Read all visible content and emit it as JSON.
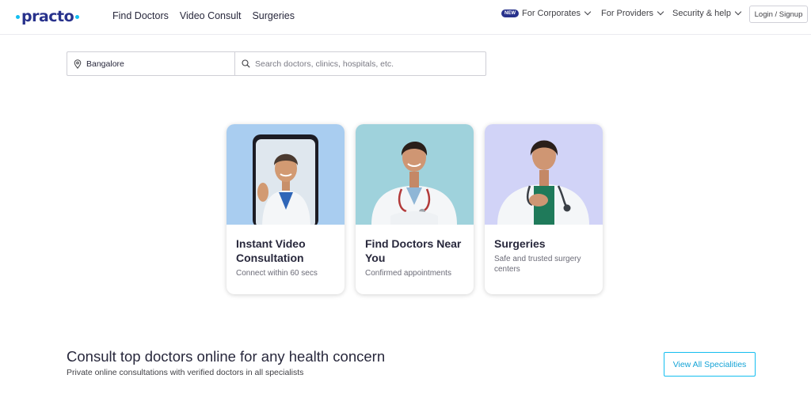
{
  "header": {
    "logo_text": "practo",
    "nav": [
      "Find Doctors",
      "Video Consult",
      "Surgeries"
    ],
    "corporates_badge": "NEW",
    "corporates_label": "For Corporates",
    "providers_label": "For Providers",
    "security_label": "Security & help",
    "login_label": "Login / Signup"
  },
  "search": {
    "location_value": "Bangalore",
    "query_placeholder": "Search doctors, clinics, hospitals, etc.",
    "query_value": ""
  },
  "cards": [
    {
      "title": "Instant Video Consultation",
      "subtitle": "Connect within 60 secs",
      "bg": "#a9cdf0"
    },
    {
      "title": "Find Doctors Near You",
      "subtitle": "Confirmed appointments",
      "bg": "#9fd2dc"
    },
    {
      "title": "Surgeries",
      "subtitle": "Safe and trusted surgery centers",
      "bg": "#d1d3f7"
    }
  ],
  "consult": {
    "title": "Consult top doctors online for any health concern",
    "subtitle": "Private online consultations with verified doctors in all specialists",
    "view_all_label": "View All Specialities"
  },
  "colors": {
    "brand_navy": "#28328c",
    "brand_cyan": "#14bef0",
    "text_dark": "#28283c"
  }
}
